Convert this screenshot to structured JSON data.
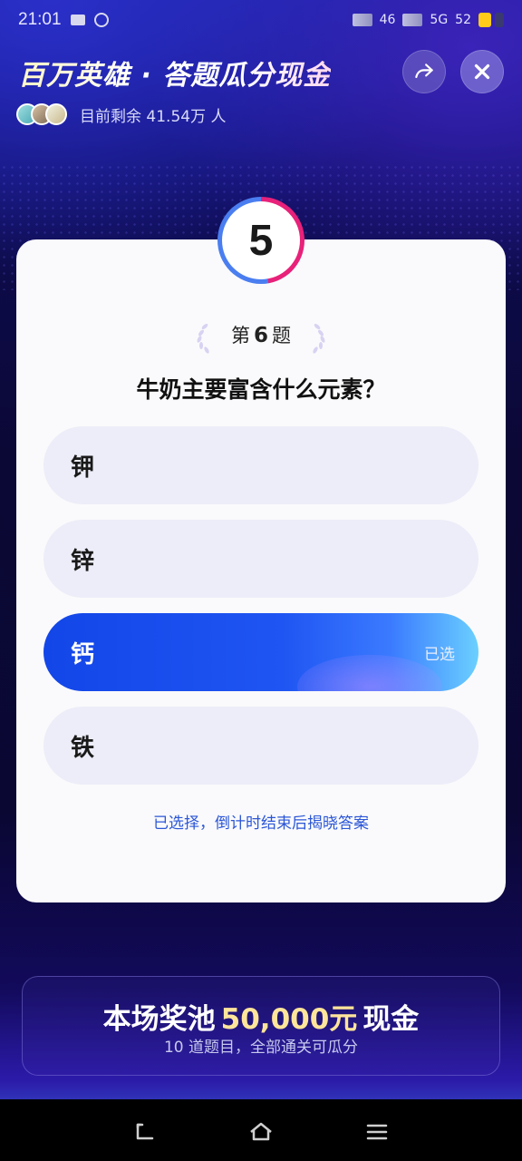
{
  "status_bar": {
    "time": "21:01",
    "network": "46",
    "network2": "5G",
    "battery": "52"
  },
  "header": {
    "title": "百万英雄 · 答题瓜分现金",
    "remaining_label": "目前剩余 41.54万 人"
  },
  "timer": {
    "seconds": "5"
  },
  "question": {
    "number_prefix": "第",
    "number": "6",
    "number_suffix": "题",
    "text": "牛奶主要富含什么元素？",
    "options": [
      {
        "label": "钾",
        "selected": false
      },
      {
        "label": "锌",
        "selected": false
      },
      {
        "label": "钙",
        "selected": true
      },
      {
        "label": "铁",
        "selected": false
      }
    ],
    "selected_tag": "已选",
    "hint": "已选择，倒计时结束后揭晓答案"
  },
  "prize_pool": {
    "prefix": "本场奖池",
    "amount": "50,000元",
    "suffix": "现金",
    "subtitle": "10 道题目，全部通关可瓜分"
  },
  "icons": {
    "share": "share-icon",
    "close": "close-icon",
    "back": "back-icon",
    "home": "home-icon",
    "menu": "menu-icon"
  },
  "colors": {
    "selected_option": "#1f55f2",
    "timer_red": "#e8217a",
    "timer_blue": "#4a7ef0",
    "hint": "#2b56d6",
    "amount": "#ffe59a"
  }
}
